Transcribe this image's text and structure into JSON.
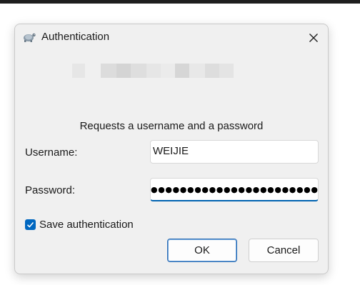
{
  "dialog": {
    "title": "Authentication",
    "app_icon": "turtle-icon",
    "close_icon": "close-icon",
    "prompt": "Requests a username and a password"
  },
  "form": {
    "username_label": "Username:",
    "username_value": "WEIJIE",
    "password_label": "Password:",
    "password_value": "●●●●●●●●●●●●●●●●●●●●●●●●●●●"
  },
  "options": {
    "save_auth_label": "Save authentication",
    "save_auth_checked": true
  },
  "buttons": {
    "ok_label": "OK",
    "cancel_label": "Cancel"
  },
  "colors": {
    "accent": "#0067c0",
    "dialog_bg": "#f0f0f0"
  }
}
